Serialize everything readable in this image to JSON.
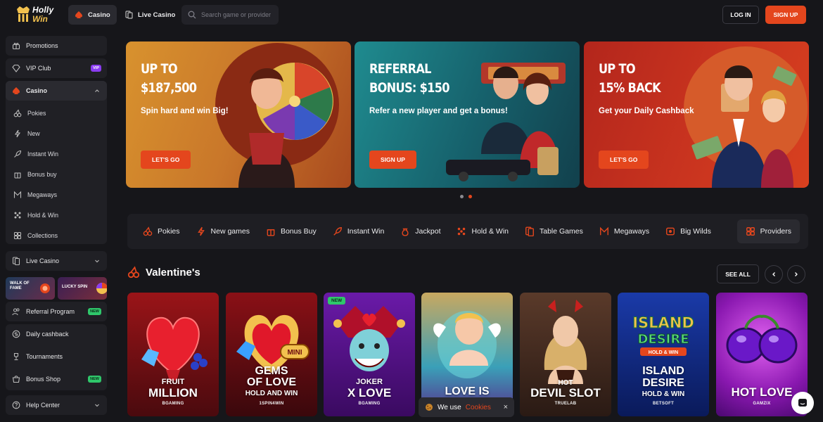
{
  "brand": {
    "line1": "Holly",
    "line2": "Win"
  },
  "header": {
    "tabs": [
      {
        "label": "Casino"
      },
      {
        "label": "Live Casino"
      }
    ],
    "search_placeholder": "Search game or provider",
    "login_label": "LOG IN",
    "signup_label": "SIGN UP"
  },
  "sidebar": {
    "promotions": "Promotions",
    "vip_club": "VIP Club",
    "vip_badge": "VIP",
    "casino": "Casino",
    "casino_items": [
      "Pokies",
      "New",
      "Instant Win",
      "Bonus buy",
      "Megaways",
      "Hold & Win",
      "Collections"
    ],
    "live_casino": "Live Casino",
    "tile_walk": "WALK OF FAME",
    "tile_lucky": "LUCKY SPIN",
    "referral": "Referral Program",
    "new_badge": "NEW",
    "daily_cashback": "Daily cashback",
    "tournaments": "Tournaments",
    "bonus_shop": "Bonus Shop",
    "help_center": "Help Center"
  },
  "banners": [
    {
      "headline": "UP TO\n$187,500",
      "sub": "Spin hard and win Big!",
      "button": "LET'S GO"
    },
    {
      "headline": "REFERRAL\nBONUS: $150",
      "sub": "Refer a new player and get a bonus!",
      "button": "SIGN UP"
    },
    {
      "headline": "UP TO\n15% BACK",
      "sub": "Get your Daily Cashback",
      "button": "LET'S GO"
    }
  ],
  "carousel": {
    "pages": 2,
    "active": 2
  },
  "categories": [
    "Pokies",
    "New games",
    "Bonus Buy",
    "Instant Win",
    "Jackpot",
    "Hold & Win",
    "Table Games",
    "Megaways",
    "Big Wilds"
  ],
  "providers_label": "Providers",
  "section": {
    "title": "Valentine's",
    "see_all": "SEE ALL"
  },
  "games": [
    {
      "line1": "FRUIT",
      "line2": "MILLION",
      "provider": "BGAMING"
    },
    {
      "line1": "GEMS",
      "line2": "OF LOVE",
      "line3": "HOLD AND WIN",
      "provider": "1SPIN4WIN"
    },
    {
      "line1": "JOKER",
      "line2": "X LOVE",
      "provider": "BGAMING",
      "tag": "NEW"
    },
    {
      "line1": "LOVE IS",
      "provider": ""
    },
    {
      "line1": "HOT",
      "line2": "DEVIL SLOT",
      "provider": "TRUELAB"
    },
    {
      "line1": "ISLAND",
      "line2": "DESIRE",
      "line3": "HOLD & WIN",
      "provider": "BETSOFT"
    },
    {
      "line1": "HOT LOVE",
      "provider": "GAMZIX"
    }
  ],
  "game_logos": {
    "gems_mini": "MINI",
    "island_top": "ISLAND",
    "island_mid": "DESIRE",
    "island_badge": "HOLD & WIN"
  },
  "cookie": {
    "text": "We use",
    "link": "Cookies",
    "close": "×"
  },
  "colors": {
    "accent": "#e4461d",
    "bg": "#16161a",
    "panel": "#202025",
    "new_badge": "#2fc76b",
    "vip_badge": "#8a3cf0"
  }
}
